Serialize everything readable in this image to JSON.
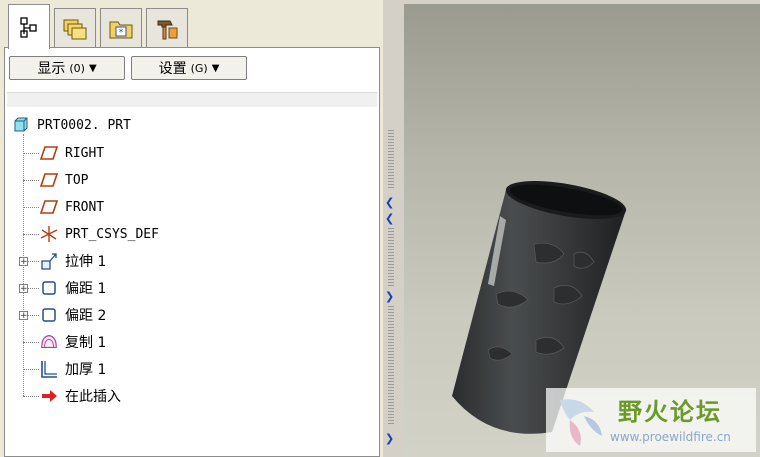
{
  "tabs": [
    {
      "name": "model-tree-tab",
      "icon": "model-tree-icon",
      "active": true
    },
    {
      "name": "folder-browser-tab",
      "icon": "folders-icon",
      "active": false
    },
    {
      "name": "favorites-tab",
      "icon": "favorites-folder-icon",
      "active": false
    },
    {
      "name": "tools-tab",
      "icon": "hammer-icon",
      "active": false
    }
  ],
  "toolbar": {
    "show": {
      "label": "显示",
      "accel": "(0)"
    },
    "settings": {
      "label": "设置",
      "accel": "(G)"
    }
  },
  "tree": {
    "root": "PRT0002. PRT",
    "items": [
      {
        "label": "RIGHT",
        "icon": "datum-plane-icon"
      },
      {
        "label": "TOP",
        "icon": "datum-plane-icon"
      },
      {
        "label": "FRONT",
        "icon": "datum-plane-icon"
      },
      {
        "label": "PRT_CSYS_DEF",
        "icon": "coordinate-system-icon"
      },
      {
        "label": "拉伸 1",
        "icon": "extrude-icon",
        "expandable": true
      },
      {
        "label": "偏距 1",
        "icon": "offset-icon",
        "expandable": true
      },
      {
        "label": "偏距 2",
        "icon": "offset-icon",
        "expandable": true
      },
      {
        "label": "复制 1",
        "icon": "copy-surface-icon"
      },
      {
        "label": "加厚 1",
        "icon": "thicken-icon"
      },
      {
        "label": "在此插入",
        "icon": "insert-here-arrow-icon"
      }
    ]
  },
  "watermark": {
    "title": "野火论坛",
    "url": "www.proewildfire.cn"
  },
  "colors": {
    "viewport_top": "#9a9a8e",
    "viewport_bottom": "#d2d2c6",
    "model_body": "#3a3c3d",
    "accent_arrow": "#e02020"
  }
}
